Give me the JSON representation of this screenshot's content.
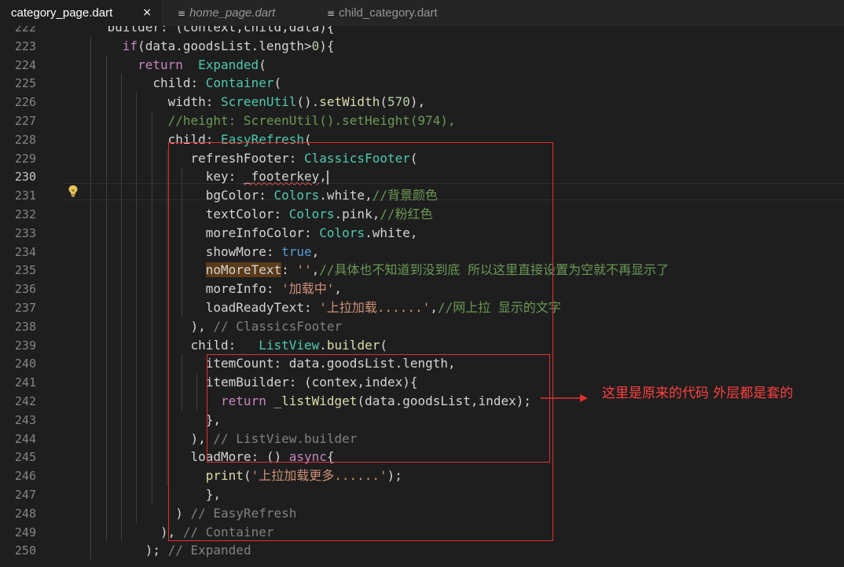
{
  "tabs": [
    {
      "label": "category_page.dart",
      "active": true,
      "close": "×"
    },
    {
      "label": "home_page.dart",
      "active": false
    },
    {
      "label": "child_category.dart",
      "active": false
    }
  ],
  "icons": {
    "file_icon": "≡",
    "bulb_icon": "lightbulb"
  },
  "colors": {
    "keyword": "#569cd6",
    "control": "#c586c0",
    "class": "#4ec9b0",
    "function": "#dcdcaa",
    "string": "#ce9178",
    "number": "#b5cea8",
    "comment": "#6a9955",
    "annotation": "#e03030"
  },
  "editor": {
    "current_line": "230",
    "line_numbers": [
      "222",
      "223",
      "224",
      "225",
      "226",
      "227",
      "228",
      "229",
      "230",
      "231",
      "232",
      "233",
      "234",
      "235",
      "236",
      "237",
      "238",
      "239",
      "240",
      "241",
      "242",
      "243",
      "244",
      "245",
      "246",
      "247",
      "248",
      "249",
      "250"
    ],
    "lines": [
      {
        "indent": "    ",
        "tokens": [
          [
            "builder: (context,child,data){",
            "id"
          ]
        ]
      },
      {
        "indent": "      ",
        "tokens": [
          [
            "if",
            "ctl"
          ],
          [
            "(data.goodsList.length>",
            "id"
          ],
          [
            "0",
            "num"
          ],
          [
            "){",
            "id"
          ]
        ]
      },
      {
        "indent": "        ",
        "tokens": [
          [
            "return",
            "ctl"
          ],
          [
            "  ",
            "id"
          ],
          [
            "Expanded",
            "cls"
          ],
          [
            "(",
            "id"
          ]
        ]
      },
      {
        "indent": "          ",
        "tokens": [
          [
            "child: ",
            "id"
          ],
          [
            "Container",
            "cls"
          ],
          [
            "(",
            "id"
          ]
        ]
      },
      {
        "indent": "            ",
        "tokens": [
          [
            "width: ",
            "id"
          ],
          [
            "ScreenUtil",
            "cls"
          ],
          [
            "().",
            "id"
          ],
          [
            "setWidth",
            "fn"
          ],
          [
            "(",
            "id"
          ],
          [
            "570",
            "num"
          ],
          [
            "),",
            "id"
          ]
        ]
      },
      {
        "indent": "            ",
        "tokens": [
          [
            "//height: ScreenUtil().setHeight(974),",
            "cmt"
          ]
        ]
      },
      {
        "indent": "            ",
        "tokens": [
          [
            "child: ",
            "id"
          ],
          [
            "EasyRefresh",
            "cls"
          ],
          [
            "(",
            "id"
          ]
        ]
      },
      {
        "indent": "               ",
        "tokens": [
          [
            "refreshFooter: ",
            "id"
          ],
          [
            "ClassicsFooter",
            "cls"
          ],
          [
            "(",
            "id"
          ]
        ]
      },
      {
        "indent": "                 ",
        "tokens": [
          [
            "key: ",
            "id"
          ],
          [
            "_footerkey",
            "sq"
          ],
          [
            ",",
            "id"
          ],
          [
            "",
            "caret"
          ]
        ]
      },
      {
        "indent": "                 ",
        "tokens": [
          [
            "bgColor: ",
            "id"
          ],
          [
            "Colors",
            "cls"
          ],
          [
            ".white,",
            "id"
          ],
          [
            "//背景颜色",
            "cmt"
          ]
        ]
      },
      {
        "indent": "                 ",
        "tokens": [
          [
            "textColor: ",
            "id"
          ],
          [
            "Colors",
            "cls"
          ],
          [
            ".pink,",
            "id"
          ],
          [
            "//粉红色",
            "cmt"
          ]
        ]
      },
      {
        "indent": "                 ",
        "tokens": [
          [
            "moreInfoColor: ",
            "id"
          ],
          [
            "Colors",
            "cls"
          ],
          [
            ".white,",
            "id"
          ]
        ]
      },
      {
        "indent": "                 ",
        "tokens": [
          [
            "showMore: ",
            "id"
          ],
          [
            "true",
            "kw"
          ],
          [
            ",",
            "id"
          ]
        ]
      },
      {
        "indent": "                 ",
        "tokens": [
          [
            "noMoreText",
            "warn"
          ],
          [
            ": ",
            "id"
          ],
          [
            "''",
            "str"
          ],
          [
            ",",
            "id"
          ],
          [
            "//具体也不知道到没到底 所以这里直接设置为空就不再显示了",
            "cmt"
          ]
        ]
      },
      {
        "indent": "                 ",
        "tokens": [
          [
            "moreInfo: ",
            "id"
          ],
          [
            "'加载中'",
            "str"
          ],
          [
            ",",
            "id"
          ]
        ]
      },
      {
        "indent": "                 ",
        "tokens": [
          [
            "loadReadyText: ",
            "id"
          ],
          [
            "'上拉加载......'",
            "str"
          ],
          [
            ",",
            "id"
          ],
          [
            "//网上拉 显示的文字",
            "cmt"
          ]
        ]
      },
      {
        "indent": "               ",
        "tokens": [
          [
            "), ",
            "id"
          ],
          [
            "// ClassicsFooter",
            "cmtg"
          ]
        ]
      },
      {
        "indent": "               ",
        "tokens": [
          [
            "child:   ",
            "id"
          ],
          [
            "ListView",
            "cls"
          ],
          [
            ".",
            "id"
          ],
          [
            "builder",
            "fn"
          ],
          [
            "(",
            "id"
          ]
        ]
      },
      {
        "indent": "                 ",
        "tokens": [
          [
            "itemCount: data.goodsList.length,",
            "id"
          ]
        ]
      },
      {
        "indent": "                 ",
        "tokens": [
          [
            "itemBuilder: (contex,index){",
            "id"
          ]
        ]
      },
      {
        "indent": "                   ",
        "tokens": [
          [
            "return",
            "ctl"
          ],
          [
            " ",
            "id"
          ],
          [
            "_listWidget",
            "fn"
          ],
          [
            "(data.goodsList,index);",
            "id"
          ]
        ]
      },
      {
        "indent": "                 ",
        "tokens": [
          [
            "},",
            "id"
          ]
        ]
      },
      {
        "indent": "               ",
        "tokens": [
          [
            "), ",
            "id"
          ],
          [
            "// ListView.builder",
            "cmtg"
          ]
        ]
      },
      {
        "indent": "               ",
        "tokens": [
          [
            "loadMore: () ",
            "id"
          ],
          [
            "async",
            "ctl"
          ],
          [
            "{",
            "id"
          ]
        ]
      },
      {
        "indent": "                 ",
        "tokens": [
          [
            "print",
            "fn"
          ],
          [
            "(",
            "id"
          ],
          [
            "'上拉加载更多......'",
            "str"
          ],
          [
            ");",
            "id"
          ]
        ]
      },
      {
        "indent": "                 ",
        "tokens": [
          [
            "},",
            "id"
          ]
        ]
      },
      {
        "indent": "             ",
        "tokens": [
          [
            ") ",
            "id"
          ],
          [
            "// EasyRefresh",
            "cmtg"
          ]
        ]
      },
      {
        "indent": "           ",
        "tokens": [
          [
            "), ",
            "id"
          ],
          [
            "// Container",
            "cmtg"
          ]
        ]
      },
      {
        "indent": "         ",
        "tokens": [
          [
            "); ",
            "id"
          ],
          [
            "// Expanded",
            "cmtg"
          ]
        ]
      }
    ]
  },
  "annotation": {
    "text": "这里是原来的代码 外层都是套的"
  }
}
